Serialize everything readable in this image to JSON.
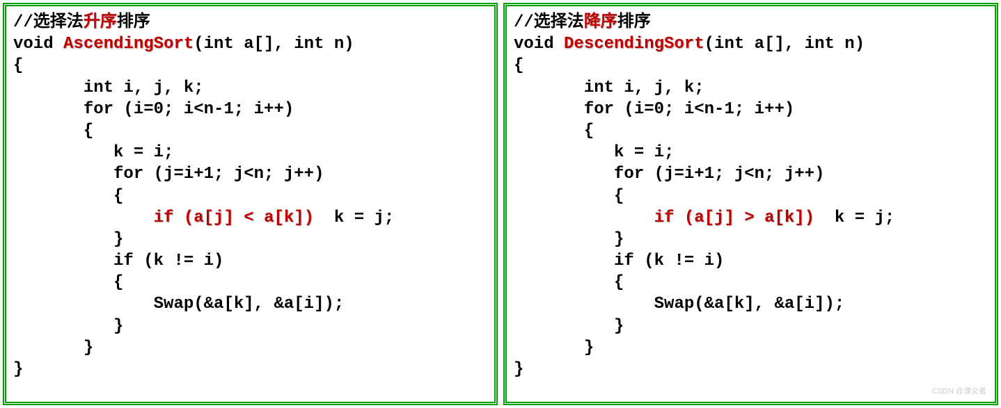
{
  "left": {
    "comment_prefix": "//选择法",
    "comment_red": "升序",
    "comment_suffix": "排序",
    "line2_a": "void ",
    "line2_red": "AscendingSort",
    "line2_b": "(int a[], int n)",
    "line3": "{",
    "line4": "       int i, j, k;",
    "line5": "       for (i=0; i<n-1; i++)",
    "line6": "       {",
    "line7": "          k = i;",
    "line8": "          for (j=i+1; j<n; j++)",
    "line9": "          {",
    "line10_pad": "              ",
    "line10_red": "if (a[j] < a[k]) ",
    "line10_b": " k = j;",
    "line11": "          }",
    "line12": "          if (k != i)",
    "line13": "          {",
    "line14": "              Swap(&a[k], &a[i]);",
    "line15": "          }",
    "line16": "       }",
    "line17": "}"
  },
  "right": {
    "comment_prefix": "//选择法",
    "comment_red": "降序",
    "comment_suffix": "排序",
    "line2_a": "void ",
    "line2_red": "DescendingSort",
    "line2_b": "(int a[], int n)",
    "line3": "{",
    "line4": "       int i, j, k;",
    "line5": "       for (i=0; i<n-1; i++)",
    "line6": "       {",
    "line7": "          k = i;",
    "line8": "          for (j=i+1; j<n; j++)",
    "line9": "          {",
    "line10_pad": "              ",
    "line10_red": "if (a[j] > a[k]) ",
    "line10_b": " k = j;",
    "line11": "          }",
    "line12": "          if (k != i)",
    "line13": "          {",
    "line14": "              Swap(&a[k], &a[i]);",
    "line15": "          }",
    "line16": "       }",
    "line17": "}"
  },
  "watermark": "CSDN @濮炎者"
}
